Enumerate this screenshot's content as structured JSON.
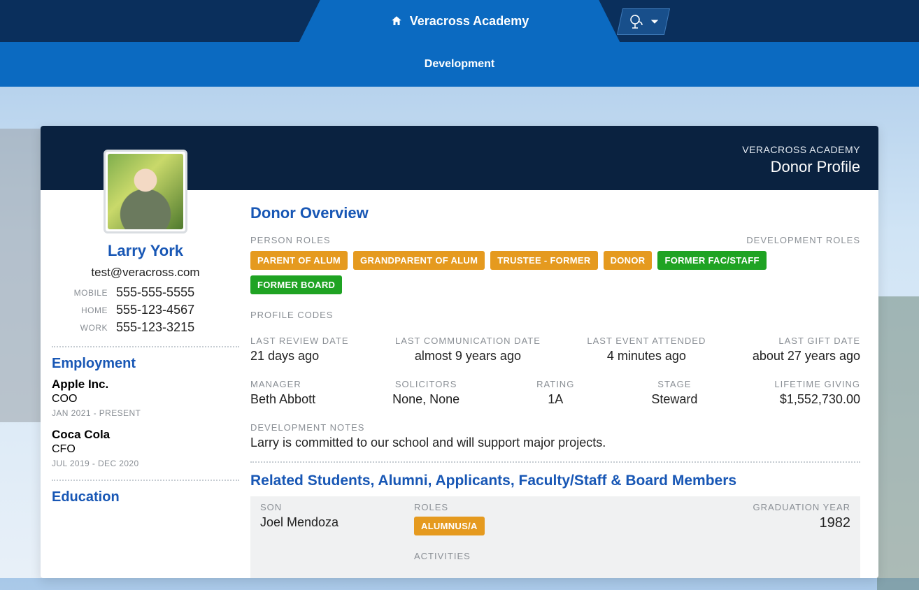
{
  "header": {
    "app_title": "Veracross Academy",
    "subnav_label": "Development"
  },
  "card": {
    "org": "VERACROSS ACADEMY",
    "page_type": "Donor Profile"
  },
  "donor": {
    "name": "Larry York",
    "email": "test@veracross.com",
    "phones": {
      "mobile_label": "MOBILE",
      "mobile": "555-555-5555",
      "home_label": "HOME",
      "home": "555-123-4567",
      "work_label": "WORK",
      "work": "555-123-3215"
    }
  },
  "employment": {
    "heading": "Employment",
    "items": [
      {
        "org": "Apple Inc.",
        "title": "COO",
        "dates": "JAN 2021 - PRESENT"
      },
      {
        "org": "Coca Cola",
        "title": "CFO",
        "dates": "JUL 2019 - DEC 2020"
      }
    ]
  },
  "education": {
    "heading": "Education"
  },
  "overview": {
    "title": "Donor Overview",
    "person_roles_label": "PERSON ROLES",
    "development_roles_label": "DEVELOPMENT ROLES",
    "person_roles": [
      "PARENT OF ALUM",
      "GRANDPARENT OF ALUM",
      "TRUSTEE - FORMER",
      "DONOR"
    ],
    "dev_roles": [
      "FORMER FAC/STAFF",
      "FORMER BOARD"
    ],
    "profile_codes_label": "PROFILE CODES",
    "stats1": {
      "last_review_label": "LAST REVIEW DATE",
      "last_review": "21 days ago",
      "last_comm_label": "LAST COMMUNICATION DATE",
      "last_comm": "almost 9 years ago",
      "last_event_label": "LAST EVENT ATTENDED",
      "last_event": "4 minutes ago",
      "last_gift_label": "LAST GIFT DATE",
      "last_gift": "about 27 years ago"
    },
    "stats2": {
      "manager_label": "MANAGER",
      "manager": "Beth Abbott",
      "solicitors_label": "SOLICITORS",
      "solicitors": "None, None",
      "rating_label": "RATING",
      "rating": "1A",
      "stage_label": "STAGE",
      "stage": "Steward",
      "lifetime_label": "LIFETIME GIVING",
      "lifetime": "$1,552,730.00"
    },
    "notes_label": "DEVELOPMENT NOTES",
    "notes": "Larry is committed to our school and will support major projects."
  },
  "related": {
    "title": "Related Students, Alumni, Applicants, Faculty/Staff & Board Members",
    "rel_label": "SON",
    "rel_name": "Joel Mendoza",
    "roles_label": "ROLES",
    "role_badge": "ALUMNUS/A",
    "grad_label": "GRADUATION YEAR",
    "grad_year": "1982",
    "activities_label": "ACTIVITIES"
  }
}
